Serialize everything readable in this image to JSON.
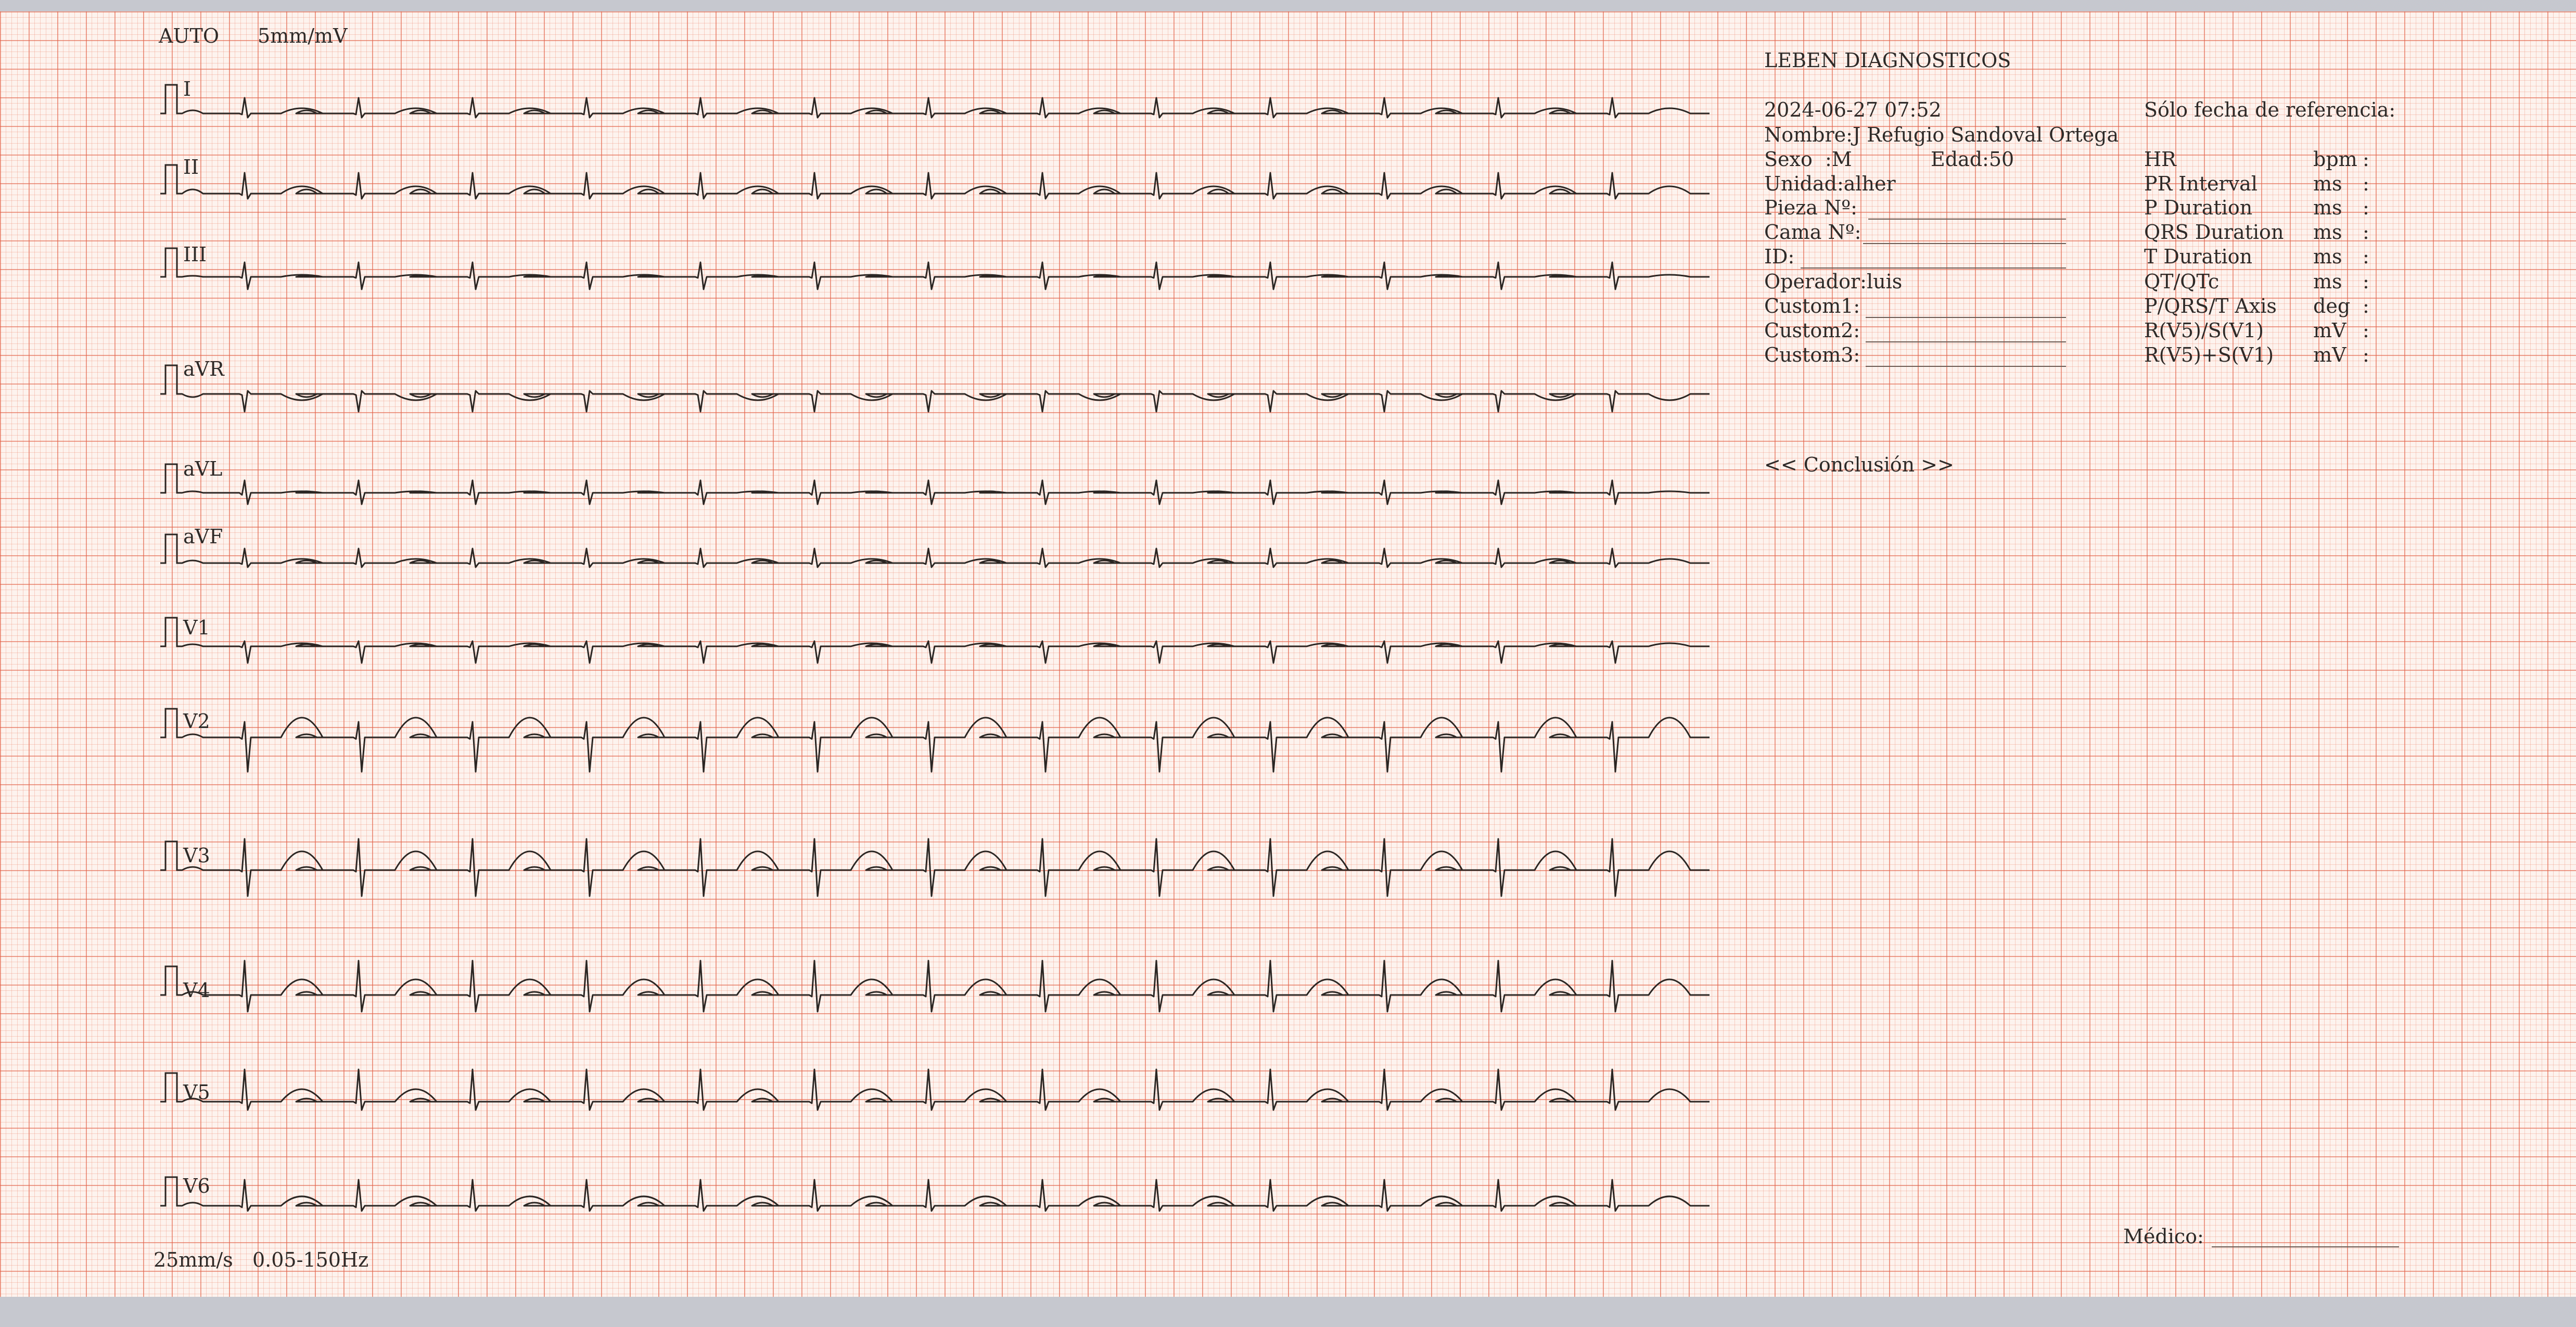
{
  "header": {
    "mode": "AUTO",
    "gain": "5mm/mV"
  },
  "footer": {
    "speed": "25mm/s",
    "filter": "0.05-150Hz"
  },
  "leads": [
    "I",
    "II",
    "III",
    "aVR",
    "aVL",
    "aVF",
    "V1",
    "V2",
    "V3",
    "V4",
    "V5",
    "V6"
  ],
  "info": {
    "institution": "LEBEN DIAGNOSTICOS",
    "datetime": "2024-06-27 07:52",
    "reference": "Sólo fecha de referencia:",
    "nombre": "Nombre:J Refugio Sandoval Ortega",
    "sexo": "Sexo  :M",
    "edad": "Edad:50",
    "unidad": "Unidad:alher",
    "pieza": "Pieza Nº:",
    "cama": "Cama Nº:",
    "id": "ID:",
    "operador": "Operador:luis",
    "custom1": "Custom1:",
    "custom2": "Custom2:",
    "custom3": "Custom3:"
  },
  "measurements": [
    {
      "name": "HR",
      "unit": "bpm",
      "sep": ":"
    },
    {
      "name": "PR Interval",
      "unit": "ms",
      "sep": ":"
    },
    {
      "name": "P Duration",
      "unit": "ms",
      "sep": ":"
    },
    {
      "name": "QRS Duration",
      "unit": "ms",
      "sep": ":"
    },
    {
      "name": "T Duration",
      "unit": "ms",
      "sep": ":"
    },
    {
      "name": "QT/QTc",
      "unit": "ms",
      "sep": ":"
    },
    {
      "name": "P/QRS/T Axis",
      "unit": "deg",
      "sep": ":"
    },
    {
      "name": "R(V5)/S(V1)",
      "unit": "mV",
      "sep": ":"
    },
    {
      "name": "R(V5)+S(V1)",
      "unit": "mV",
      "sep": ":"
    }
  ],
  "conclusion_label": "<< Conclusión >>",
  "medico_label": "Médico:",
  "colors": {
    "grid_major": "#e26048",
    "grid_minor": "#ec8c76",
    "trace": "#2b2623",
    "paper": "#fdf3ee"
  }
}
